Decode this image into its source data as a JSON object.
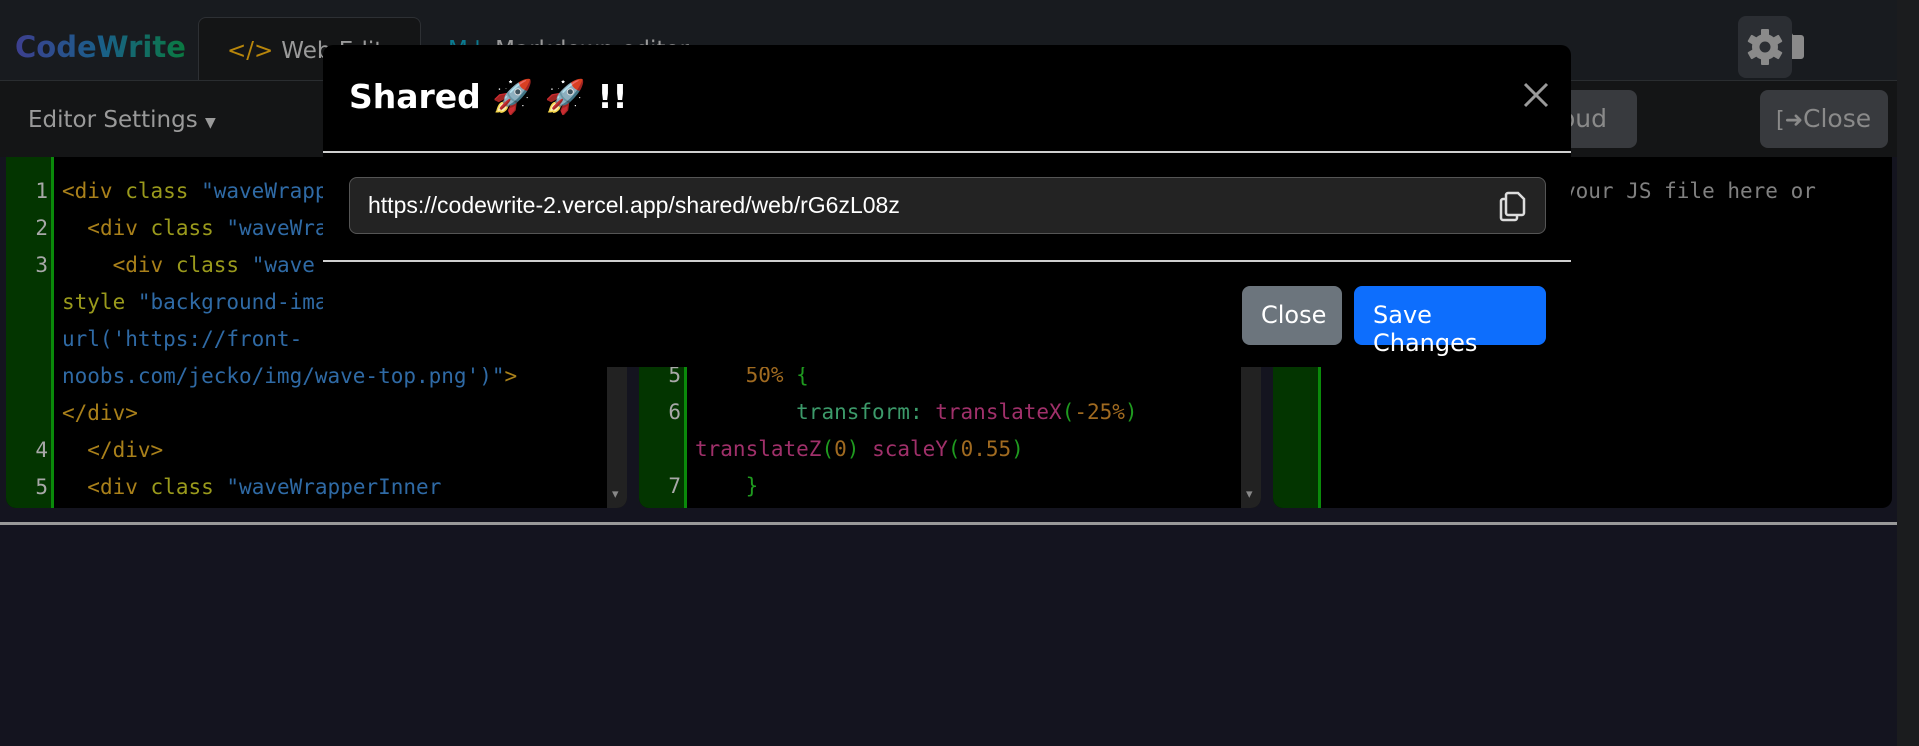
{
  "brand": "CodeWrite",
  "tabs": [
    {
      "icon": "</>",
      "label": "Web Edit",
      "icon_name": "code-icon"
    },
    {
      "icon": "M↓",
      "label": "Markdown editor",
      "icon_name": "markdown-icon"
    }
  ],
  "toolbar": {
    "settings_label": "Editor Settings",
    "cloud_label": "oud",
    "close_label": "Close"
  },
  "editors": {
    "html_lines": [
      "1",
      "2",
      "3",
      "",
      "",
      "",
      "",
      "4",
      "5"
    ],
    "css_lines": [
      "5",
      "6",
      "",
      "7"
    ],
    "js_placeholder": "your JS file here or"
  },
  "modal": {
    "title": "Shared 🚀 🚀 !!",
    "url": "https://codewrite-2.vercel.app/shared/web/rG6zL08z",
    "close_label": "Close",
    "save_label": "Save Changes"
  },
  "colors": {
    "primary": "#0d6efd",
    "secondary": "#6c757d",
    "gutter": "#033500"
  }
}
